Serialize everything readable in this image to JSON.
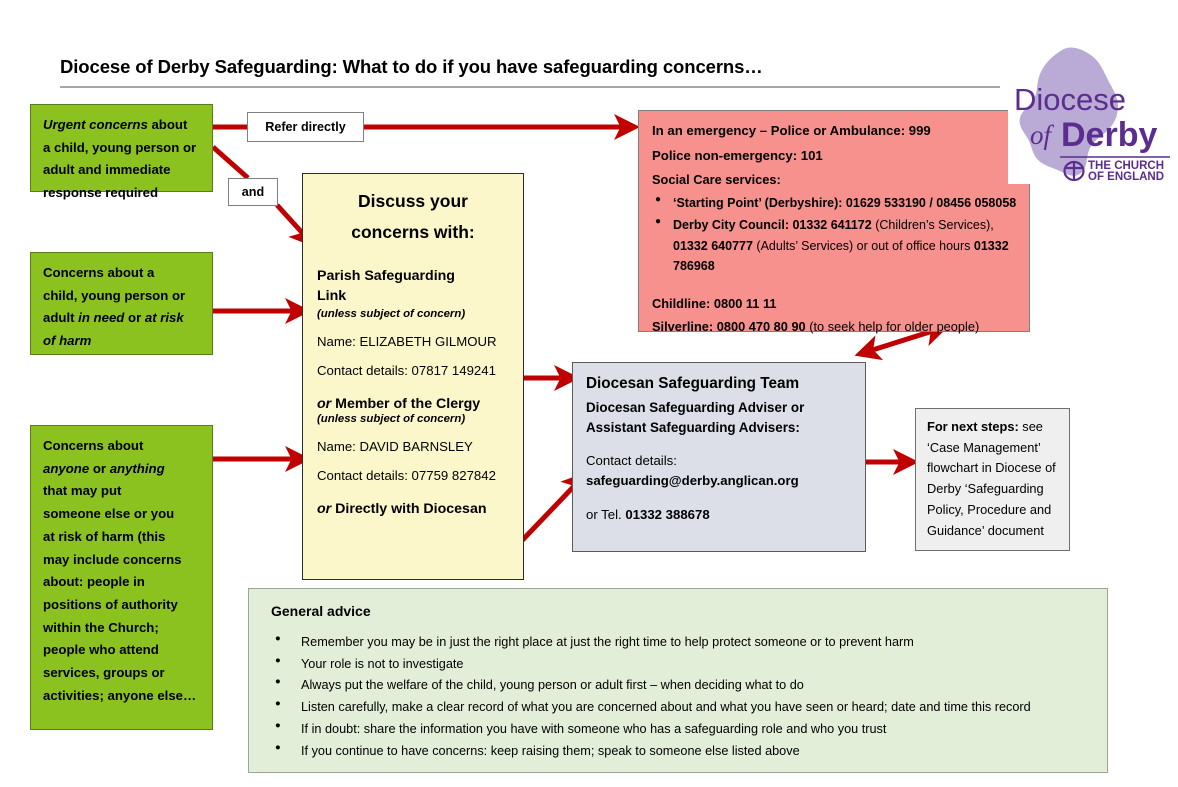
{
  "title": "Diocese of Derby Safeguarding: What to do if you have safeguarding concerns…",
  "colors": {
    "green": "#8CC220",
    "yellow": "#FCF6CB",
    "pink": "#F7918E",
    "grey": "#DCDFE8",
    "light_grey": "#EFEFEF",
    "pale_green": "#E3EED9",
    "arrow_red": "#C00000",
    "logo_purple": "#5B2D8E",
    "logo_map_fill": "#B9ABD6"
  },
  "green_boxes": [
    {
      "id": "urgent-concerns",
      "lines": [
        {
          "italic": "Urgent concerns",
          "normal": " about"
        },
        {
          "normal": "a child, young person or"
        },
        {
          "normal": "adult and immediate"
        },
        {
          "normal": "response required"
        }
      ]
    },
    {
      "id": "in-need-at-risk",
      "lines": [
        {
          "normal": "Concerns about a"
        },
        {
          "normal": "child, young person or"
        },
        {
          "normal": "adult "
        },
        {
          "normal": "of harm"
        }
      ],
      "rich": "Concerns about a child, young person or adult in need or at risk of harm"
    },
    {
      "id": "anyone-anything",
      "rich": "Concerns about anyone or anything that may put someone else or you at risk of harm (this may include concerns about: people in positions of authority within the Church; people who attend services, groups or activities; anyone else…"
    }
  ],
  "connector_labels": {
    "refer_directly": "Refer directly",
    "and": "and"
  },
  "discuss_box": {
    "heading_line1": "Discuss your",
    "heading_line2": "concerns with:",
    "parish_link_line1": "Parish Safeguarding",
    "parish_link_line2": "Link",
    "parish_note": "(unless subject of concern)",
    "parish_name": "Name: ELIZABETH GILMOUR",
    "parish_contact": "Contact details: 07817 149241",
    "clergy_or": "or",
    "clergy_title": " Member of the Clergy",
    "clergy_note": "(unless subject of concern)",
    "clergy_name": "Name: DAVID BARNSLEY",
    "clergy_contact": "Contact details:  07759 827842",
    "diocesan_or": "or",
    "diocesan_title": " Directly with Diocesan"
  },
  "emergency_box": {
    "line_emergency": "In an emergency – Police or Ambulance:  999",
    "line_non_emergency": "Police non-emergency: 101",
    "social_care_heading": "Social Care services:",
    "bullets": [
      {
        "bold_prefix": "‘Starting Point’ (Derbyshire): 01629 533190 / 08456  058058",
        "segments": [
          {
            "text": "‘Starting Point’ (Derbyshire): 01629 533190 / 08456  058058",
            "bold": true
          }
        ]
      },
      {
        "segments": [
          {
            "text": "Derby City Council:  01332 641172 ",
            "bold": true
          },
          {
            "text": "(Children’s Services), ",
            "bold": false
          },
          {
            "text": "01332 640777 ",
            "bold": true
          },
          {
            "text": "(Adults’ Services)  or out of office hours  ",
            "bold": false
          },
          {
            "text": "01332 786968",
            "bold": true
          }
        ]
      }
    ],
    "childline": "Childline: 0800 11 11",
    "silverline_bold": "Silverline: 0800 470 80 90",
    "silverline_note": " (to seek help for older people)"
  },
  "diocesan_box": {
    "title": "Diocesan Safeguarding Team",
    "subtitle_line1": "Diocesan Safeguarding Adviser or",
    "subtitle_line2": "Assistant Safeguarding Advisers:",
    "contact_label": "Contact details:",
    "email": "safeguarding@derby.anglican.org",
    "tel_prefix": "or Tel.  ",
    "tel": "01332 388678"
  },
  "next_steps_box": {
    "heading": "For next steps:",
    "body": "see ‘Case Management’ flowchart in Diocese of Derby ‘Safeguarding Policy, Procedure and Guidance’ document"
  },
  "general_advice": {
    "heading": "General advice",
    "items": [
      "Remember you may be in just the right place at just the right time to help protect someone or to prevent harm",
      "Your role is not to investigate",
      "Always put the welfare of the child, young person or adult first – when deciding what to do",
      "Listen carefully, make a clear record of what you are concerned about and what you have seen or heard; date and time this record",
      "If in doubt: share the information you have with someone who has a safeguarding role and who you trust",
      "If you continue to have concerns: keep raising them; speak to someone else listed above"
    ]
  },
  "logo": {
    "word_diocese": "Diocese",
    "word_of": "of",
    "word_derby": "Derby",
    "church_line1": "THE CHURCH",
    "church_line2": "OF ENGLAND"
  }
}
